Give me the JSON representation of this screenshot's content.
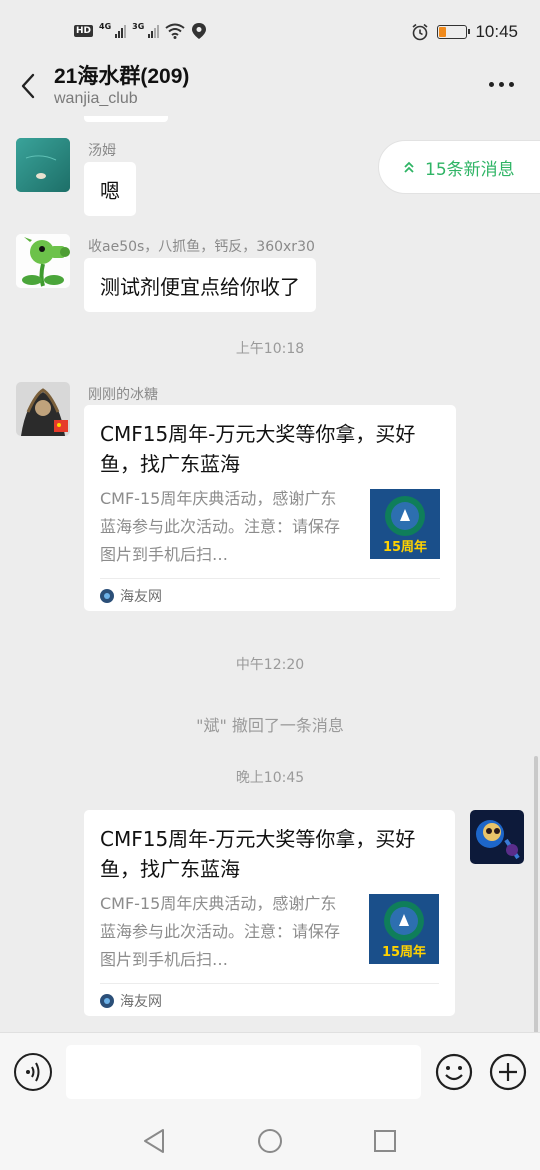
{
  "status_bar": {
    "time": "10:45",
    "network_hd": "HD",
    "network_1": "4G",
    "network_2": "3G",
    "battery_level": 0.25
  },
  "header": {
    "title": "21海水群(209)",
    "subtitle": "wanjia_club"
  },
  "new_messages_pill": {
    "label": "15条新消息"
  },
  "messages": [
    {
      "type": "text",
      "sender": "汤姆",
      "text": "嗯"
    },
    {
      "type": "text",
      "sender": "收ae50s，八抓鱼，钙反，360xr30",
      "text": "测试剂便宜点给你收了"
    }
  ],
  "timestamps": [
    "上午10:18",
    "中午12:20",
    "晚上10:45"
  ],
  "link_card_1": {
    "sender": "刚刚的冰糖",
    "title": "CMF15周年-万元大奖等你拿，买好鱼，找广东蓝海",
    "desc": "CMF-15周年庆典活动，感谢广东蓝海参与此次活动。注意：请保存图片到手机后扫…",
    "thumb_text": "15周年",
    "source": "海友网"
  },
  "recall_notice": "\"斌\" 撤回了一条消息",
  "link_card_2": {
    "title": "CMF15周年-万元大奖等你拿，买好鱼，找广东蓝海",
    "desc": "CMF-15周年庆典活动，感谢广东蓝海参与此次活动。注意：请保存图片到手机后扫…",
    "thumb_text": "15周年",
    "source": "海友网"
  },
  "input_bar": {
    "placeholder": ""
  },
  "colors": {
    "accent_green": "#2fb465",
    "background": "#ededed",
    "bubble": "#ffffff"
  }
}
